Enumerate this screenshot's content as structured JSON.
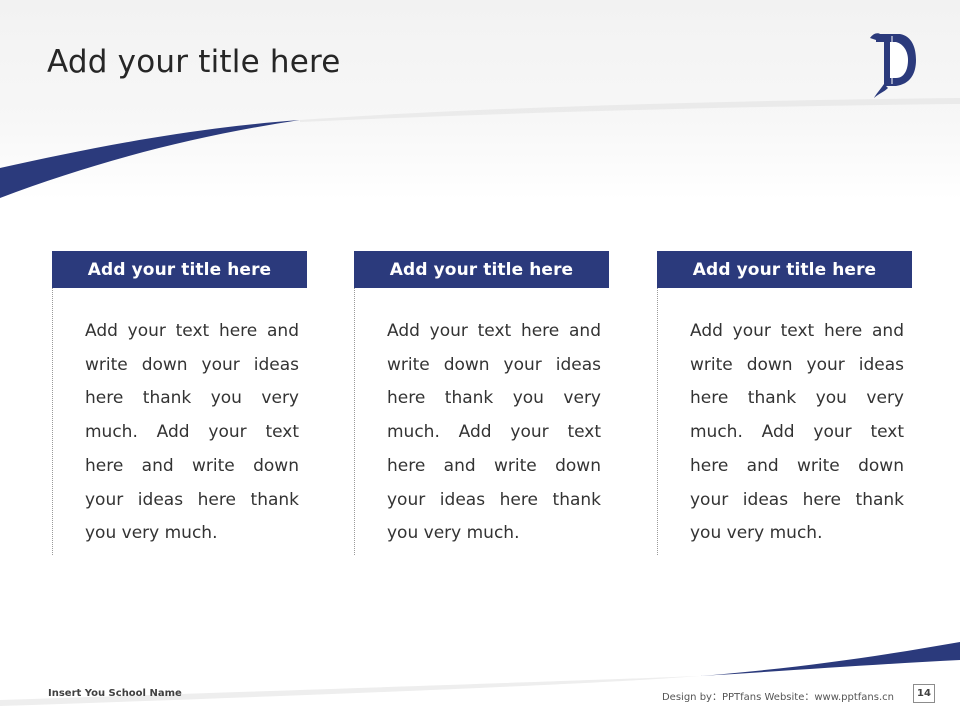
{
  "slide": {
    "title": "Add your title here",
    "logo_icon": "gothic-letter-d-logo",
    "accent_color": "#2b3a7c"
  },
  "cards": [
    {
      "title": "Add your title here",
      "body": "Add your text here and write down your ideas here thank you very much. Add your text here and write down your ideas here thank you very much."
    },
    {
      "title": "Add your title here",
      "body": "Add your text here and write down your ideas here thank you very much. Add your text here and write down your ideas here thank you very much."
    },
    {
      "title": "Add your title here",
      "body": "Add your text here and write down your ideas here thank you very much. Add your text here and write down your ideas here thank you very much."
    }
  ],
  "footer": {
    "school_name": "Insert You School Name",
    "credit": "Design by：PPTfans   Website：www.pptfans.cn",
    "page_number": "14"
  }
}
